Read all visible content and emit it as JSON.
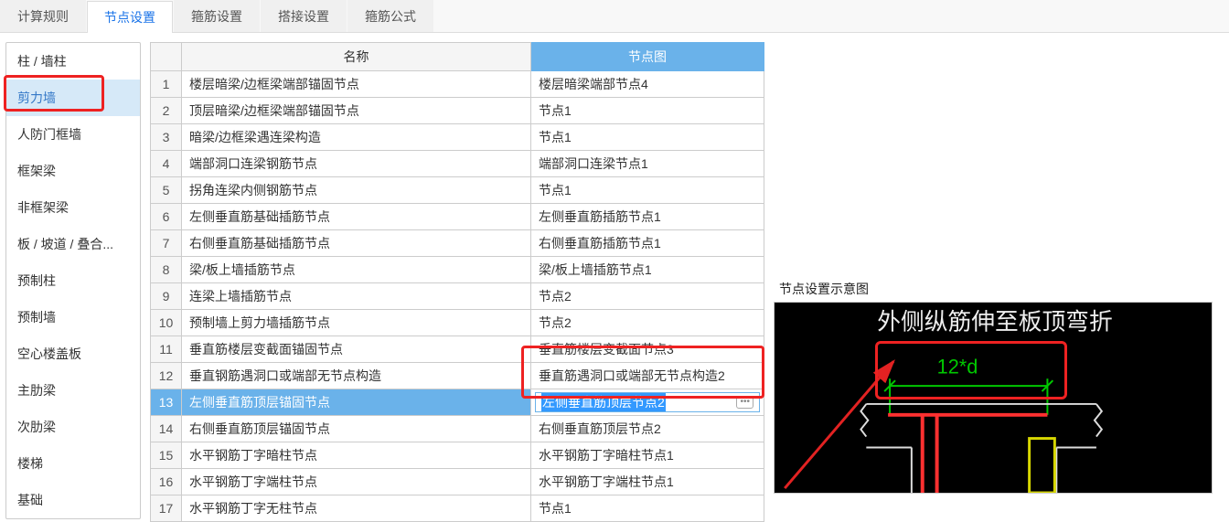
{
  "tabs": {
    "calc_rules": "计算规则",
    "node_settings": "节点设置",
    "hoop_settings": "箍筋设置",
    "lap_settings": "搭接设置",
    "hoop_formula": "箍筋公式"
  },
  "sidebar": {
    "items": [
      "柱 / 墙柱",
      "剪力墙",
      "人防门框墙",
      "框架梁",
      "非框架梁",
      "板 / 坡道 / 叠合...",
      "预制柱",
      "预制墙",
      "空心楼盖板",
      "主肋梁",
      "次肋梁",
      "楼梯",
      "基础"
    ],
    "active_index": 1
  },
  "table": {
    "headers": {
      "name": "名称",
      "node_img": "节点图"
    },
    "selected_header": "node_img",
    "selected_row": 13,
    "edit_value": "左侧垂直筋顶层节点2",
    "rows": [
      {
        "n": 1,
        "name": "楼层暗梁/边框梁端部锚固节点",
        "node": "楼层暗梁端部节点4"
      },
      {
        "n": 2,
        "name": "顶层暗梁/边框梁端部锚固节点",
        "node": "节点1"
      },
      {
        "n": 3,
        "name": "暗梁/边框梁遇连梁构造",
        "node": "节点1"
      },
      {
        "n": 4,
        "name": "端部洞口连梁钢筋节点",
        "node": "端部洞口连梁节点1"
      },
      {
        "n": 5,
        "name": "拐角连梁内侧钢筋节点",
        "node": "节点1"
      },
      {
        "n": 6,
        "name": "左侧垂直筋基础插筋节点",
        "node": "左侧垂直筋插筋节点1"
      },
      {
        "n": 7,
        "name": "右侧垂直筋基础插筋节点",
        "node": "右侧垂直筋插筋节点1"
      },
      {
        "n": 8,
        "name": "梁/板上墙插筋节点",
        "node": "梁/板上墙插筋节点1"
      },
      {
        "n": 9,
        "name": "连梁上墙插筋节点",
        "node": "节点2"
      },
      {
        "n": 10,
        "name": "预制墙上剪力墙插筋节点",
        "node": "节点2"
      },
      {
        "n": 11,
        "name": "垂直筋楼层变截面锚固节点",
        "node": "垂直筋楼层变截面节点3"
      },
      {
        "n": 12,
        "name": "垂直钢筋遇洞口或端部无节点构造",
        "node": "垂直筋遇洞口或端部无节点构造2"
      },
      {
        "n": 13,
        "name": "左侧垂直筋顶层锚固节点",
        "node": "左侧垂直筋顶层节点2"
      },
      {
        "n": 14,
        "name": "右侧垂直筋顶层锚固节点",
        "node": "右侧垂直筋顶层节点2"
      },
      {
        "n": 15,
        "name": "水平钢筋丁字暗柱节点",
        "node": "水平钢筋丁字暗柱节点1"
      },
      {
        "n": 16,
        "name": "水平钢筋丁字端柱节点",
        "node": "水平钢筋丁字端柱节点1"
      },
      {
        "n": 17,
        "name": "水平钢筋丁字无柱节点",
        "node": "节点1"
      }
    ]
  },
  "diagram": {
    "title": "节点设置示意图",
    "top_text": "外侧纵筋伸至板顶弯折",
    "dim_text": "12*d",
    "colors": {
      "green": "#00c800",
      "white": "#eeeeee",
      "red": "#e22222",
      "yellow": "#d6d600"
    }
  }
}
